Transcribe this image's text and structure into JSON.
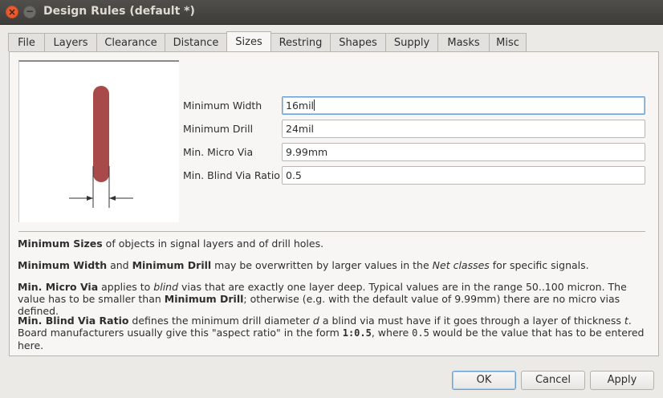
{
  "window": {
    "title": "Design Rules (default *)"
  },
  "tabs": [
    {
      "label": "File"
    },
    {
      "label": "Layers"
    },
    {
      "label": "Clearance"
    },
    {
      "label": "Distance"
    },
    {
      "label": "Sizes"
    },
    {
      "label": "Restring"
    },
    {
      "label": "Shapes"
    },
    {
      "label": "Supply"
    },
    {
      "label": "Masks"
    },
    {
      "label": "Misc"
    }
  ],
  "active_tab": "Sizes",
  "fields": [
    {
      "label": "Minimum Width",
      "value": "16mil"
    },
    {
      "label": "Minimum Drill",
      "value": "24mil"
    },
    {
      "label": "Min. Micro Via",
      "value": "9.99mm"
    },
    {
      "label": "Min. Blind Via Ratio",
      "value": "0.5"
    }
  ],
  "help": {
    "p1": {
      "b1": "Minimum Sizes",
      "t1": " of objects in signal layers and of drill holes."
    },
    "p2": {
      "b1": "Minimum Width",
      "t1": " and ",
      "b2": "Minimum Drill",
      "t2": " may be overwritten by larger values in the ",
      "i1": "Net classes",
      "t3": " for specific signals."
    },
    "p3": {
      "b1": "Min. Micro Via",
      "t1": " applies to ",
      "i1": "blind",
      "t2": " vias that are exactly one layer deep. Typical values are in the range 50..100 micron. The value has to be smaller than ",
      "b2": "Minimum Drill",
      "t3": "; otherwise (e.g. with the default value of 9.99mm) there are no micro vias defined."
    },
    "p4": {
      "b1": "Min. Blind Via Ratio",
      "t1": " defines the minimum drill diameter ",
      "i1": "d",
      "t2": " a blind via must have if it goes through a layer of thickness ",
      "i2": "t",
      "t3": ". Board manufacturers usually give this \"aspect ratio\" in the form ",
      "m1": "1:0.5",
      "t4": ", where ",
      "m2": "0.5",
      "t5": " would be the value that has to be entered here."
    }
  },
  "buttons": {
    "ok": "OK",
    "cancel": "Cancel",
    "apply": "Apply"
  },
  "colors": {
    "trace": "#a94a4a",
    "titlebar": "#3d3c38",
    "close_button": "#e95a2f",
    "focus": "#6aa0d2"
  }
}
